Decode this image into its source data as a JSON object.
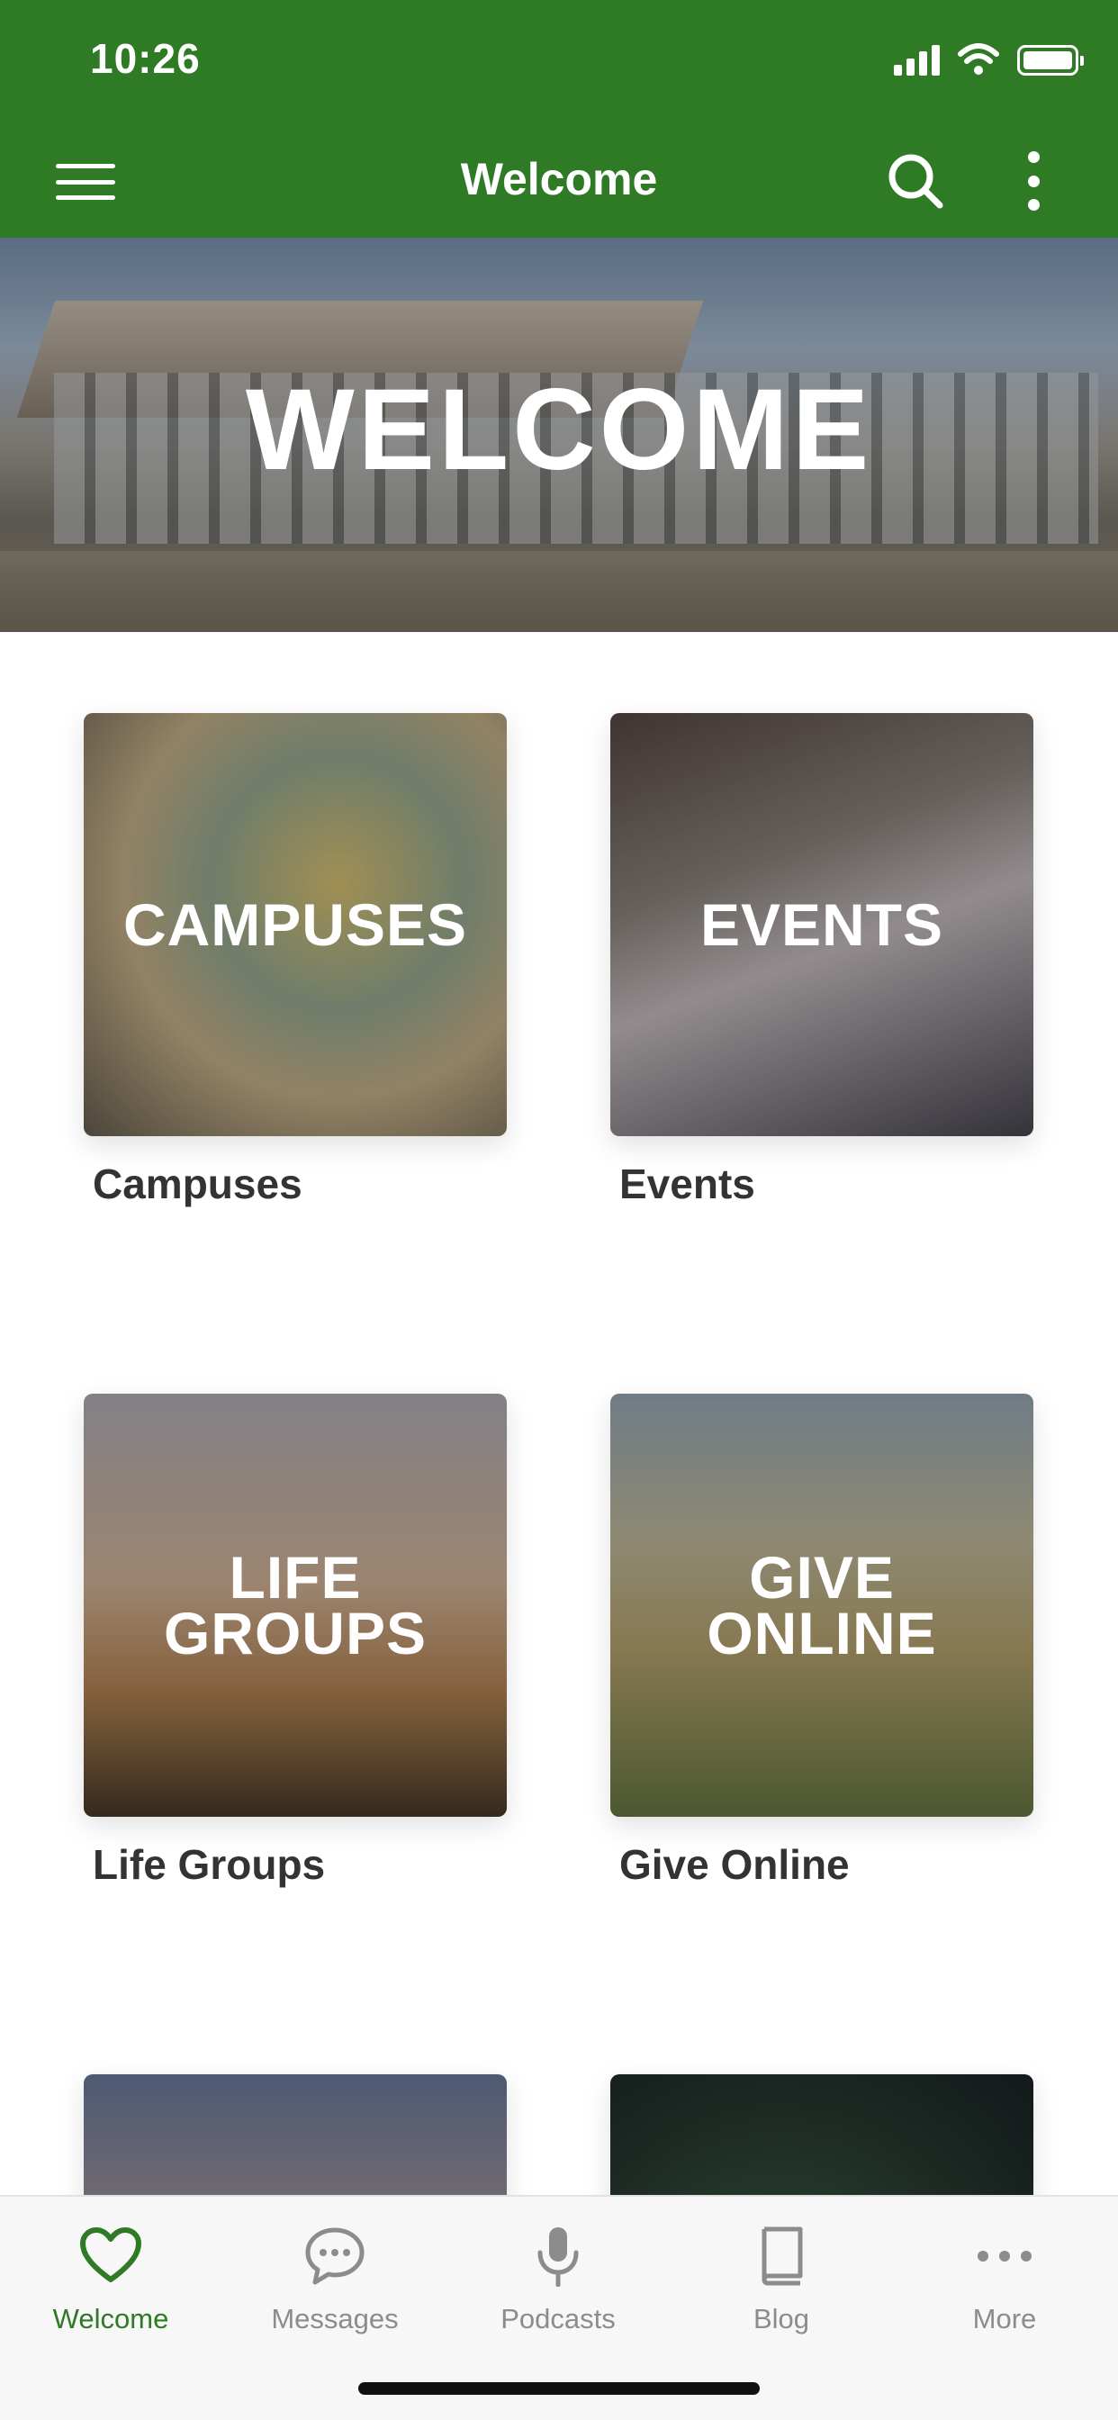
{
  "status": {
    "time": "10:26"
  },
  "nav": {
    "title": "Welcome"
  },
  "hero": {
    "title": "WELCOME"
  },
  "tiles": [
    {
      "overlay": "CAMPUSES",
      "caption": "Campuses"
    },
    {
      "overlay": "EVENTS",
      "caption": "Events"
    },
    {
      "overlay": "LIFE\nGROUPS",
      "caption": "Life Groups"
    },
    {
      "overlay": "GIVE\nONLINE",
      "caption": "Give Online"
    }
  ],
  "tabs": [
    {
      "label": "Welcome",
      "icon": "heart-icon",
      "active": true
    },
    {
      "label": "Messages",
      "icon": "chat-bubble-icon"
    },
    {
      "label": "Podcasts",
      "icon": "microphone-icon"
    },
    {
      "label": "Blog",
      "icon": "book-icon"
    },
    {
      "label": "More",
      "icon": "ellipsis-icon"
    }
  ],
  "colors": {
    "brand_green": "#2f7a24",
    "tab_inactive": "#8c8c8c"
  }
}
